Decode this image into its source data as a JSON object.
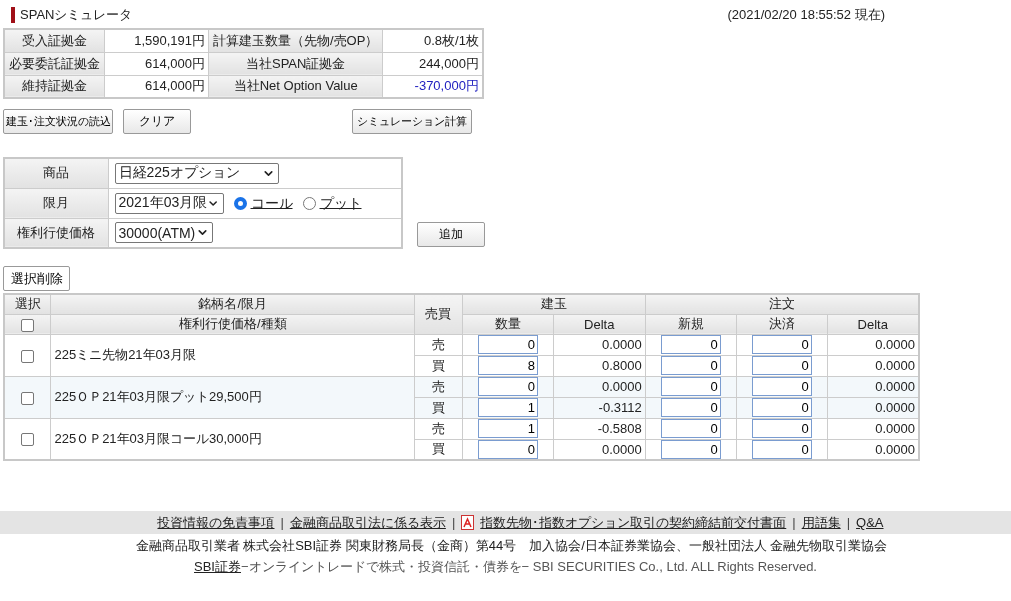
{
  "title": "SPANシミュレータ",
  "timestamp": "(2021/02/20 18:55:52 現在)",
  "summary": [
    [
      {
        "label": "受入証拠金",
        "value": "1,590,191円",
        "kind": "normal"
      },
      {
        "label": "計算建玉数量（先物/売OP）",
        "value": "0.8枚/1枚",
        "kind": "normal"
      }
    ],
    [
      {
        "label": "必要委託証拠金",
        "value": "614,000円",
        "kind": "normal"
      },
      {
        "label": "当社SPAN証拠金",
        "value": "244,000円",
        "kind": "normal"
      }
    ],
    [
      {
        "label": "維持証拠金",
        "value": "614,000円",
        "kind": "normal"
      },
      {
        "label": "当社Net Option Value",
        "value": "-370,000円",
        "kind": "negative"
      }
    ]
  ],
  "buttons": {
    "load": "建玉･注文状況の読込",
    "clear": "クリア",
    "calc": "シミュレーション計算"
  },
  "form": {
    "product_label": "商品",
    "product": "日経225オプション",
    "month_label": "限月",
    "month": "2021年03月限",
    "types": [
      {
        "label": "コール",
        "selected": true
      },
      {
        "label": "プット",
        "selected": false
      }
    ],
    "strike_label": "権利行使価格",
    "strike": "30000(ATM)",
    "add": "追加"
  },
  "delete_button": "選択削除",
  "table": {
    "select_header": "選択",
    "select_all_checked": false,
    "name_header_1": "銘柄名/限月",
    "name_header_2": "権利行使価格/種類",
    "side_header": "売買",
    "position_header": "建玉",
    "order_header": "注文",
    "qty_header": "数量",
    "delta_header": "Delta",
    "new_header": "新規",
    "close_header": "決済",
    "order_delta_header": "Delta",
    "groups": [
      {
        "name": "225ミニ先物21年03月限",
        "checked": false,
        "legs": [
          {
            "side": "売",
            "qty": "0",
            "delta": "0.0000",
            "new": "0",
            "close": "0",
            "order_delta": "0.0000"
          },
          {
            "side": "買",
            "qty": "8",
            "delta": "0.8000",
            "new": "0",
            "close": "0",
            "order_delta": "0.0000"
          }
        ]
      },
      {
        "name": "225ＯＰ21年03月限プット29,500円",
        "checked": false,
        "legs": [
          {
            "side": "売",
            "qty": "0",
            "delta": "0.0000",
            "new": "0",
            "close": "0",
            "order_delta": "0.0000"
          },
          {
            "side": "買",
            "qty": "1",
            "delta": "-0.3112",
            "new": "0",
            "close": "0",
            "order_delta": "0.0000"
          }
        ]
      },
      {
        "name": "225ＯＰ21年03月限コール30,000円",
        "checked": false,
        "legs": [
          {
            "side": "売",
            "qty": "1",
            "delta": "-0.5808",
            "new": "0",
            "close": "0",
            "order_delta": "0.0000"
          },
          {
            "side": "買",
            "qty": "0",
            "delta": "0.0000",
            "new": "0",
            "close": "0",
            "order_delta": "0.0000"
          }
        ]
      }
    ]
  },
  "footer": {
    "separator": "|",
    "links": [
      {
        "label": "投資情報の免責事項",
        "kind": "link"
      },
      {
        "label": "金融商品取引法に係る表示",
        "kind": "link"
      },
      {
        "label": "指数先物･指数オプション取引の契約締結前交付書面",
        "kind": "pdf"
      },
      {
        "label": "用語集",
        "kind": "link"
      },
      {
        "label": "Q&A",
        "kind": "link"
      }
    ],
    "registration": "金融商品取引業者 株式会社SBI証券 関東財務局長（金商）第44号　加入協会/日本証券業協会、一般社団法人 金融先物取引業協会",
    "copyright_link": "SBI証券",
    "copyright": "−オンライントレードで株式・投資信託・債券を− SBI SECURITIES Co., Ltd. ALL Rights Reserved."
  }
}
